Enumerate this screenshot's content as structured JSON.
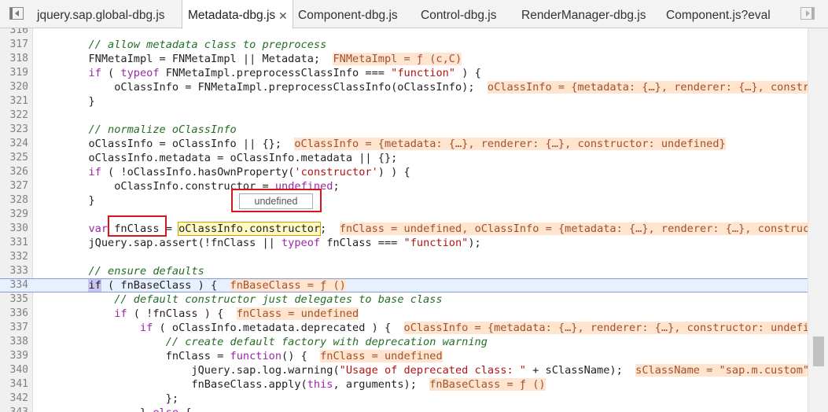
{
  "tabs": [
    {
      "label": "jquery.sap.global-dbg.js",
      "active": false
    },
    {
      "label": "Metadata-dbg.js",
      "active": true
    },
    {
      "label": "Component-dbg.js",
      "active": false
    },
    {
      "label": "Control-dbg.js",
      "active": false
    },
    {
      "label": "RenderManager-dbg.js",
      "active": false
    },
    {
      "label": "Component.js?eval",
      "active": false
    }
  ],
  "tab_close_glyph": "✕",
  "editor": {
    "lines": [
      {
        "n": "316",
        "segs": []
      },
      {
        "n": "317",
        "segs": [
          {
            "t": "        "
          },
          {
            "t": "// allow metadata class to preprocess",
            "c": "cm"
          }
        ]
      },
      {
        "n": "318",
        "segs": [
          {
            "t": "        FNMetaImpl = FNMetaImpl || Metadata;  "
          },
          {
            "t": "FNMetaImpl = ƒ (c,C)",
            "c": "vl"
          }
        ]
      },
      {
        "n": "319",
        "segs": [
          {
            "t": "        "
          },
          {
            "t": "if",
            "c": "kw"
          },
          {
            "t": " ( "
          },
          {
            "t": "typeof",
            "c": "kw"
          },
          {
            "t": " FNMetaImpl.preprocessClassInfo === "
          },
          {
            "t": "\"function\"",
            "c": "st"
          },
          {
            "t": " ) {"
          }
        ]
      },
      {
        "n": "320",
        "segs": [
          {
            "t": "            oClassInfo = FNMetaImpl.preprocessClassInfo(oClassInfo);  "
          },
          {
            "t": "oClassInfo = {metadata: {…}, renderer: {…}, constructor: undefined}",
            "c": "vl"
          }
        ]
      },
      {
        "n": "321",
        "segs": [
          {
            "t": "        }"
          }
        ]
      },
      {
        "n": "322",
        "segs": []
      },
      {
        "n": "323",
        "segs": [
          {
            "t": "        "
          },
          {
            "t": "// normalize oClassInfo",
            "c": "cm"
          }
        ]
      },
      {
        "n": "324",
        "segs": [
          {
            "t": "        oClassInfo = oClassInfo || {};  "
          },
          {
            "t": "oClassInfo = {metadata: {…}, renderer: {…}, constructor: undefined}",
            "c": "vl"
          }
        ]
      },
      {
        "n": "325",
        "segs": [
          {
            "t": "        oClassInfo.metadata = oClassInfo.metadata || {};"
          }
        ]
      },
      {
        "n": "326",
        "segs": [
          {
            "t": "        "
          },
          {
            "t": "if",
            "c": "kw"
          },
          {
            "t": " ( !oClassInfo.hasOwnProperty("
          },
          {
            "t": "'constructor'",
            "c": "st"
          },
          {
            "t": ") ) {"
          }
        ]
      },
      {
        "n": "327",
        "segs": [
          {
            "t": "            oClassInfo.constructor = "
          },
          {
            "t": "undefined",
            "c": "kw"
          },
          {
            "t": ";"
          }
        ]
      },
      {
        "n": "328",
        "segs": [
          {
            "t": "        }"
          }
        ]
      },
      {
        "n": "329",
        "segs": []
      },
      {
        "n": "330",
        "segs": [
          {
            "t": "        "
          },
          {
            "t": "var",
            "c": "kw"
          },
          {
            "t": " fnClass = "
          },
          {
            "t": "oClassInfo.constructor",
            "c": "hlbox"
          },
          {
            "t": ";  "
          },
          {
            "t": "fnClass = undefined, oClassInfo = {metadata: {…}, renderer: {…}, constructor: undefined}",
            "c": "vl"
          }
        ]
      },
      {
        "n": "331",
        "segs": [
          {
            "t": "        jQuery.sap.assert(!fnClass || "
          },
          {
            "t": "typeof",
            "c": "kw"
          },
          {
            "t": " fnClass === "
          },
          {
            "t": "\"function\"",
            "c": "st"
          },
          {
            "t": ");"
          }
        ]
      },
      {
        "n": "332",
        "segs": []
      },
      {
        "n": "333",
        "segs": [
          {
            "t": "        "
          },
          {
            "t": "// ensure defaults",
            "c": "cm"
          }
        ]
      },
      {
        "n": "334",
        "segs": [
          {
            "t": "        "
          },
          {
            "t": "if",
            "c": "execkw"
          },
          {
            "t": " ( fnBaseClass ) {  "
          },
          {
            "t": "fnBaseClass = ƒ ()",
            "c": "vl"
          }
        ]
      },
      {
        "n": "335",
        "segs": [
          {
            "t": "            "
          },
          {
            "t": "// default constructor just delegates to base class",
            "c": "cm"
          }
        ]
      },
      {
        "n": "336",
        "segs": [
          {
            "t": "            "
          },
          {
            "t": "if",
            "c": "kw"
          },
          {
            "t": " ( !fnClass ) {  "
          },
          {
            "t": "fnClass = undefined",
            "c": "vl"
          }
        ]
      },
      {
        "n": "337",
        "segs": [
          {
            "t": "                "
          },
          {
            "t": "if",
            "c": "kw"
          },
          {
            "t": " ( oClassInfo.metadata.deprecated ) {  "
          },
          {
            "t": "oClassInfo = {metadata: {…}, renderer: {…}, constructor: undefined}",
            "c": "vl"
          }
        ]
      },
      {
        "n": "338",
        "segs": [
          {
            "t": "                    "
          },
          {
            "t": "// create default factory with deprecation warning",
            "c": "cm"
          }
        ]
      },
      {
        "n": "339",
        "segs": [
          {
            "t": "                    fnClass = "
          },
          {
            "t": "function",
            "c": "kw"
          },
          {
            "t": "() {  "
          },
          {
            "t": "fnClass = undefined",
            "c": "vl"
          }
        ]
      },
      {
        "n": "340",
        "segs": [
          {
            "t": "                        jQuery.sap.log.warning("
          },
          {
            "t": "\"Usage of deprecated class: \"",
            "c": "st"
          },
          {
            "t": " + sClassName);  "
          },
          {
            "t": "sClassName = \"sap.m.custom\"",
            "c": "vl"
          }
        ]
      },
      {
        "n": "341",
        "segs": [
          {
            "t": "                        fnBaseClass.apply("
          },
          {
            "t": "this",
            "c": "kw"
          },
          {
            "t": ", arguments);  "
          },
          {
            "t": "fnBaseClass = ƒ ()",
            "c": "vl"
          }
        ]
      },
      {
        "n": "342",
        "segs": [
          {
            "t": "                    };"
          }
        ]
      },
      {
        "n": "343",
        "segs": [
          {
            "t": "                } "
          },
          {
            "t": "else",
            "c": "kw"
          },
          {
            "t": " {"
          }
        ]
      }
    ],
    "exec_line": "334"
  },
  "tooltip": {
    "text": "undefined"
  },
  "highlight_color": "#d8141c"
}
